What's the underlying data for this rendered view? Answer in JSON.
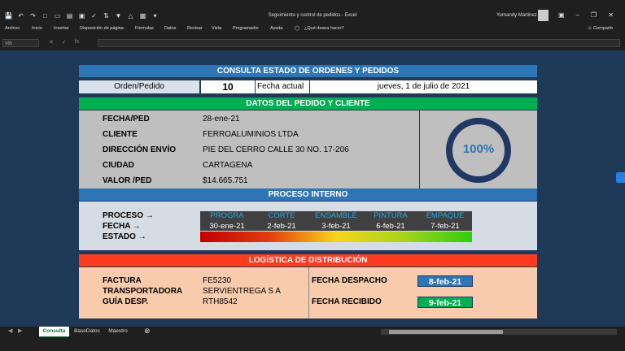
{
  "window": {
    "title": "Seguimiento y control de pedidos  -  Excel",
    "user": "Yornandy Martinez"
  },
  "ribbon": {
    "tabs": [
      "Archivo",
      "Inicio",
      "Insertar",
      "Disposición de página",
      "Fórmulas",
      "Datos",
      "Revisar",
      "Vista",
      "Programador",
      "Ayuda"
    ],
    "tell_me": "¿Qué desea hacer?",
    "share": "Compartir"
  },
  "formula_bar": {
    "name_box": "V65"
  },
  "dashboard": {
    "title": "CONSULTA ESTADO DE ORDENES Y PEDIDOS",
    "order_label": "Orden/Pedido",
    "order_value": "10",
    "date_label": "Fecha actual",
    "date_value": "jueves, 1 de julio de 2021",
    "client_section": "DATOS DEL PEDIDO Y CLIENTE",
    "fields": [
      {
        "label": "FECHA/PED",
        "value": "28-ene-21"
      },
      {
        "label": "CLIENTE",
        "value": "FERROALUMINIOS LTDA"
      },
      {
        "label": "DIRECCIÓN ENVÍO",
        "value": "PIE DEL CERRO CALLE 30 NO. 17-206"
      },
      {
        "label": "CIUDAD",
        "value": "CARTAGENA"
      },
      {
        "label": "VALOR /PED",
        "value": "$14.665.751"
      }
    ],
    "progress_text": "100%",
    "progress_fraction": 1.0,
    "process_section": "PROCESO INTERNO",
    "process_labels": [
      "PROCESO →",
      "FECHA →",
      "ESTADO →"
    ],
    "stages": [
      {
        "name": "PROGRA",
        "date": "30-ene-21"
      },
      {
        "name": "CORTE",
        "date": "2-feb-21"
      },
      {
        "name": "ENSAMBLE",
        "date": "3-feb-21"
      },
      {
        "name": "PINTURA",
        "date": "6-feb-21"
      },
      {
        "name": "EMPAQUE",
        "date": "7-feb-21"
      }
    ],
    "logistics_section": "LOGÍSTICA DE DISTRIBUCIÓN",
    "logistics": [
      {
        "label": "FACTURA",
        "value": "FE5230"
      },
      {
        "label": "TRANSPORTADORA",
        "value": "SERVIENTREGA S A"
      },
      {
        "label": "GUÍA DESP.",
        "value": "RTH8542"
      }
    ],
    "dispatch_label": "FECHA DESPACHO",
    "dispatch_value": "8-feb-21",
    "received_label": "FECHA RECIBIDO",
    "received_value": "9-feb-21"
  },
  "sheet_tabs": [
    "Consulta",
    "BaseDatos",
    "Maestro"
  ],
  "colors": {
    "header_blue": "#2e75b6",
    "header_green": "#00b050",
    "header_red": "#ff3b1f",
    "progress_ring": "#1f3864",
    "progress_text": "#2e75b6",
    "dispatch_fill": "#2e75b6",
    "received_fill": "#00b050"
  }
}
